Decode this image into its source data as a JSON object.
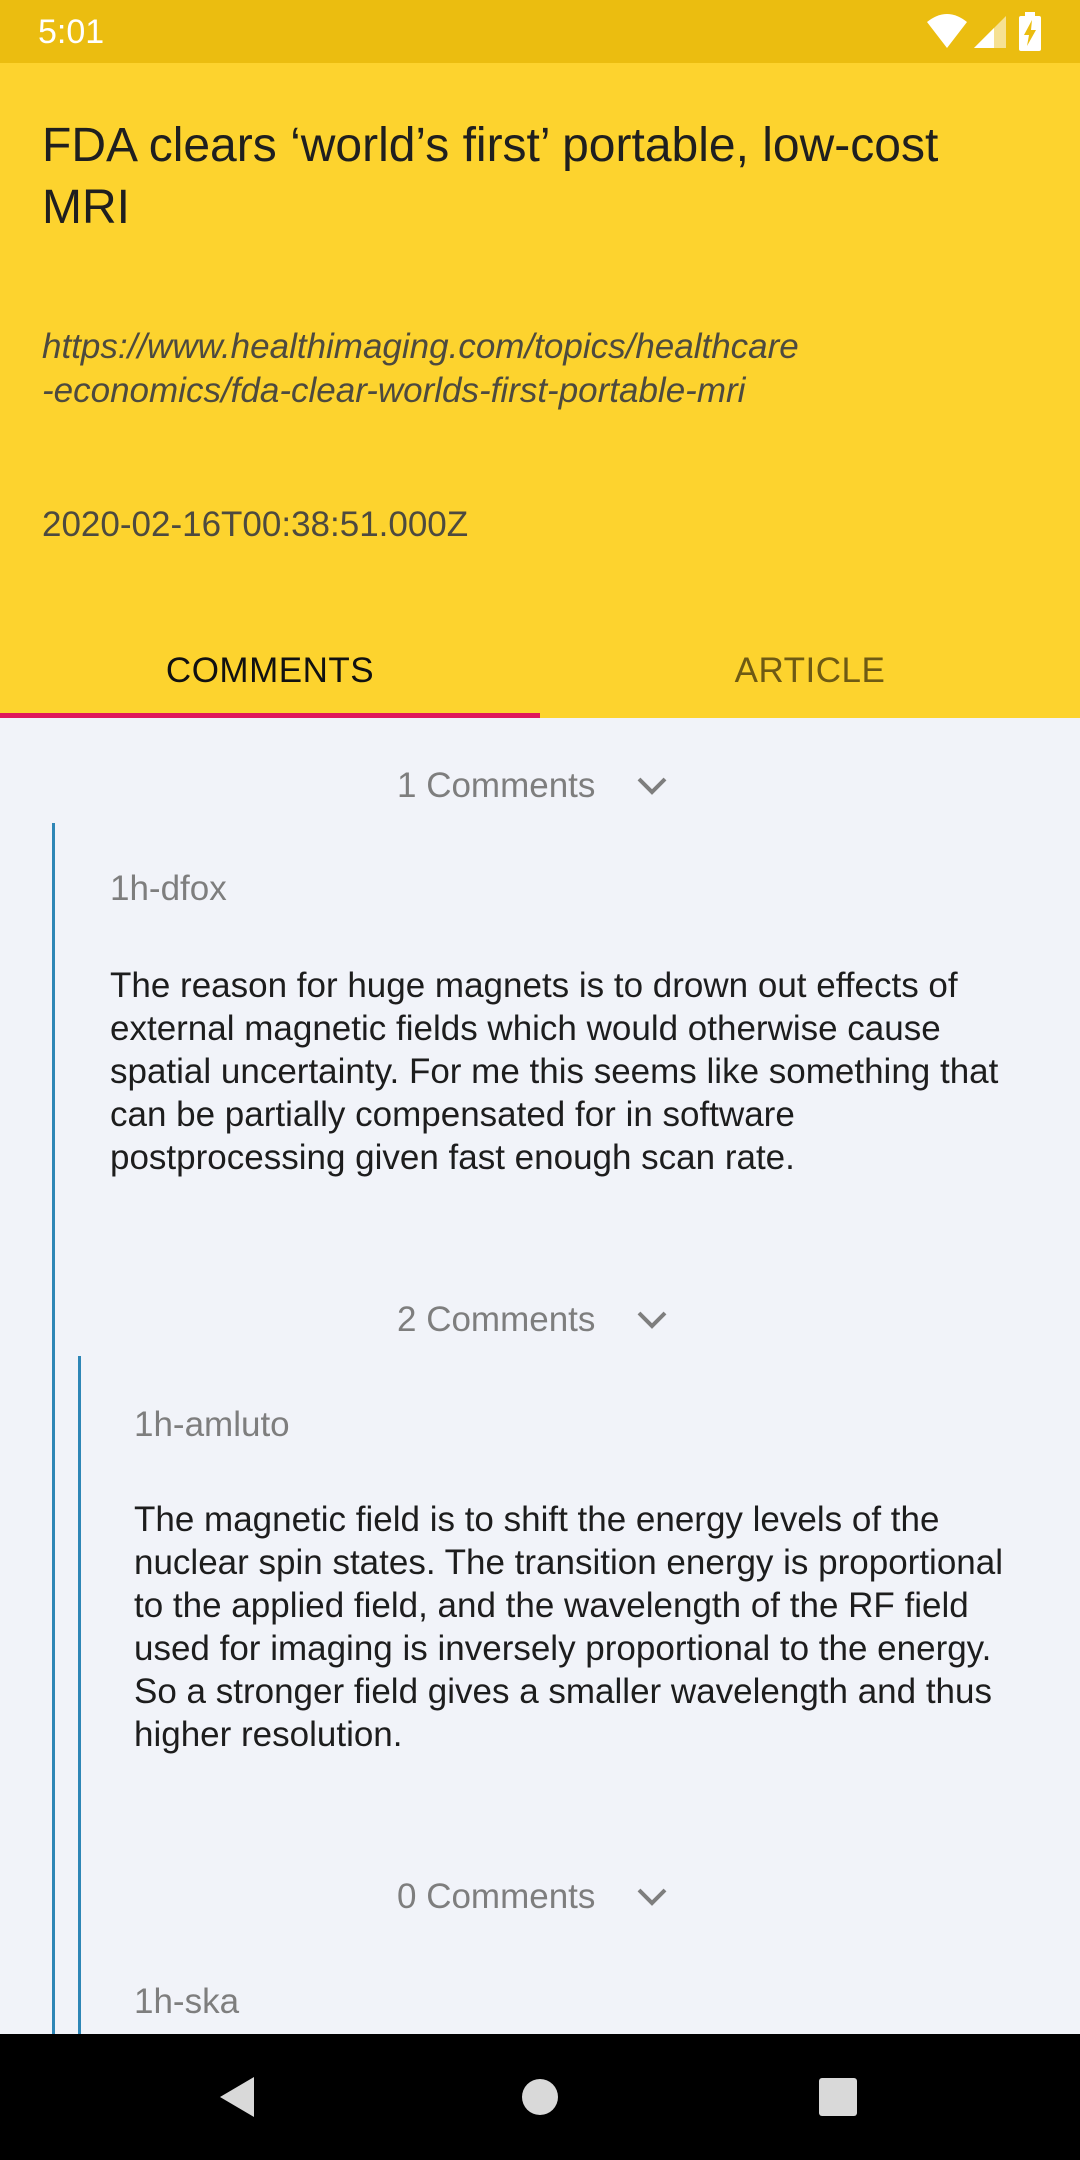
{
  "status_bar": {
    "time": "5:01",
    "icons": [
      "wifi-icon",
      "signal-icon",
      "battery-charging-icon"
    ]
  },
  "header": {
    "title": "FDA clears ‘world’s first’ portable, low-cost MRI",
    "url": "https://www.healthimaging.com/topics/healthcare\n-economics/fda-clear-worlds-first-portable-mri",
    "timestamp": "2020-02-16T00:38:51.000Z"
  },
  "tabs": [
    {
      "label": "COMMENTS",
      "selected": true
    },
    {
      "label": "ARTICLE",
      "selected": false
    }
  ],
  "thread": {
    "root_toggle": "1 Comments",
    "comments": [
      {
        "author": "1h-dfox",
        "text": "The reason for huge magnets is to drown out effects of external magnetic fields which would otherwise cause spatial uncertainty. For me this seems like something that can be partially compensated for in software postprocessing given fast enough scan rate.",
        "replies_toggle": "2 Comments"
      },
      {
        "author": "1h-amluto",
        "text": "The magnetic field is to shift the energy levels of the nuclear spin states. The transition energy is proportional to the applied field, and the wavelength of the RF field used for imaging is inversely proportional to the energy. So a stronger field gives a smaller wavelength and thus higher resolution.",
        "replies_toggle": "0 Comments"
      },
      {
        "author": "1h-ska"
      }
    ]
  },
  "nav_bar": {
    "buttons": [
      "back-icon",
      "home-icon",
      "recents-icon"
    ]
  },
  "colors": {
    "status_bar": "#EBBD10",
    "header": "#FDD32E",
    "tab_indicator": "#E0175A",
    "thread_line": "#2E86B6",
    "content_bg": "#F1F3F9"
  }
}
